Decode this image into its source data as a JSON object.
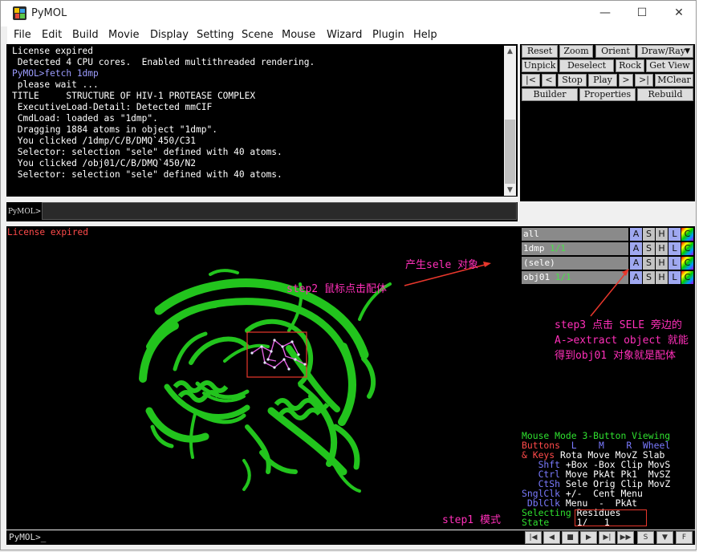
{
  "window": {
    "title": "PyMOL"
  },
  "window_controls": {
    "minimize": "—",
    "maximize": "☐",
    "close": "✕"
  },
  "menu": [
    "File",
    "Edit",
    "Build",
    "Movie",
    "Display",
    "Setting",
    "Scene",
    "Mouse",
    "Wizard",
    "Plugin",
    "Help"
  ],
  "output_lines": [
    {
      "text": "License expired",
      "color": "#ffffff"
    },
    {
      "text": " Detected 4 CPU cores.  Enabled multithreaded rendering.",
      "color": "#ffffff"
    },
    {
      "text": "PyMOL>fetch 1dmp",
      "color": "#9d9dff"
    },
    {
      "text": " please wait ...",
      "color": "#ffffff"
    },
    {
      "text": "TITLE     STRUCTURE OF HIV-1 PROTEASE COMPLEX",
      "color": "#ffffff"
    },
    {
      "text": " ExecutiveLoad-Detail: Detected mmCIF",
      "color": "#ffffff"
    },
    {
      "text": " CmdLoad: loaded as \"1dmp\".",
      "color": "#ffffff"
    },
    {
      "text": " Dragging 1884 atoms in object \"1dmp\".",
      "color": "#ffffff"
    },
    {
      "text": " You clicked /1dmp/C/B/DMQ`450/C31",
      "color": "#ffffff"
    },
    {
      "text": " Selector: selection \"sele\" defined with 40 atoms.",
      "color": "#ffffff"
    },
    {
      "text": " You clicked /obj01/C/B/DMQ`450/N2",
      "color": "#ffffff"
    },
    {
      "text": " Selector: selection \"sele\" defined with 40 atoms.",
      "color": "#ffffff"
    }
  ],
  "command_prompt": "PyMOL>",
  "control_buttons": {
    "row1": [
      "Reset",
      "Zoom",
      "Orient",
      "Draw/Ray"
    ],
    "row2": [
      "Unpick",
      "Deselect",
      "Rock",
      "Get View"
    ],
    "row3": [
      "|<",
      "<",
      "Stop",
      "Play",
      ">",
      ">|",
      "MClear"
    ],
    "row4": [
      "Builder",
      "Properties",
      "Rebuild"
    ]
  },
  "viewer": {
    "license_text": "License expired",
    "bottom_prompt": "PyMOL>_"
  },
  "annotations": {
    "sele_object": "产生sele 对象",
    "step2": "step2 鼠标点击配体",
    "step3_line1": "step3 点击 SELE 旁边的",
    "step3_line2": "A->extract object 就能",
    "step3_line3": "得到obj01 对象就是配体",
    "step1": "step1 模式"
  },
  "objects": [
    {
      "name": "all",
      "count": ""
    },
    {
      "name": "1dmp",
      "count": "1/1"
    },
    {
      "name": "(sele)",
      "count": ""
    },
    {
      "name": "obj01",
      "count": "1/1"
    }
  ],
  "object_action_labels": [
    "A",
    "S",
    "H",
    "L",
    "C"
  ],
  "mouse_mode": {
    "title_a": "Mouse Mode",
    "title_b": "3-Button Viewing",
    "buttons_row": [
      "Buttons",
      "L",
      "M",
      "R",
      "Wheel"
    ],
    "rows": [
      [
        "& Keys",
        "Rota",
        "Move",
        "MovZ",
        "Slab"
      ],
      [
        "Shft",
        "+Box",
        "-Box",
        "Clip",
        "MovS"
      ],
      [
        "Ctrl",
        "Move",
        "PkAt",
        "Pk1",
        "MvSZ"
      ],
      [
        "CtSh",
        "Sele",
        "Orig",
        "Clip",
        "MovZ"
      ],
      [
        "SnglClk",
        "+/-",
        "Cent",
        "Menu",
        ""
      ],
      [
        "DblClk",
        "Menu",
        "-",
        "PkAt",
        ""
      ]
    ],
    "selecting_label": "Selecting",
    "selecting_value": "Residues",
    "state_label": "State",
    "state_value": "1/",
    "state_total": "1"
  },
  "transport": [
    "|◀",
    "◀",
    "■",
    "▶",
    "▶|",
    "▶▶",
    "S",
    "▼",
    "F"
  ],
  "colors": {
    "viewer_bg": "#000000",
    "protein": "#22c41d",
    "annotation": "#ff2fb9",
    "arrow": "#e8372c",
    "prompt_blue": "#9d9dff",
    "object_button_a": "#9fa8f0",
    "object_button_s": "#c3c3c3",
    "mouse_mode_green": "#2fe02f",
    "mouse_mode_red": "#ff4a4a",
    "mouse_mode_blue": "#7a7aff"
  }
}
